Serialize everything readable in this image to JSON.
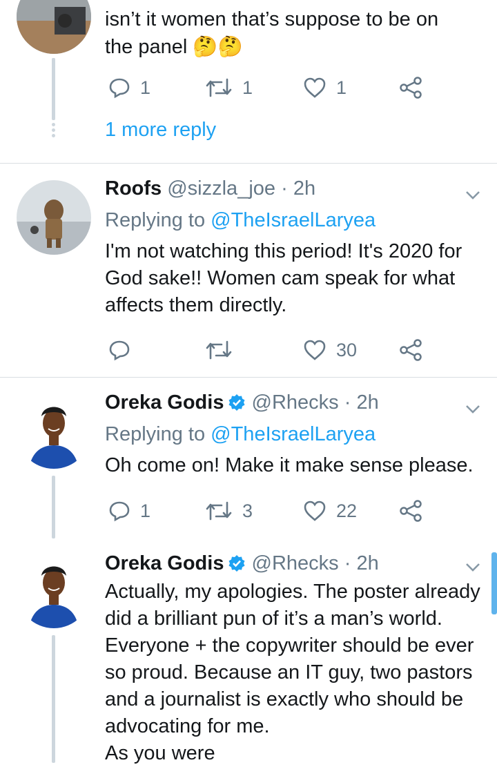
{
  "top_tweet": {
    "text_line1": "isn’t it women that’s suppose to be on",
    "text_line2": "the panel",
    "emoji": "🤔🤔",
    "reply_count": "1",
    "retweet_count": "1",
    "like_count": "1",
    "more_replies": "1 more reply"
  },
  "tweets": [
    {
      "name": "Roofs",
      "handle": "@sizzla_joe",
      "time": "2h",
      "replying_label": "Replying to",
      "replying_to": "@TheIsraelLaryea",
      "text": "I'm not watching this period! It's 2020 for God sake!! Women cam speak for what affects them directly.",
      "reply_count": "",
      "retweet_count": "",
      "like_count": "30"
    },
    {
      "name": "Oreka Godis",
      "handle": "@Rhecks",
      "time": "2h",
      "replying_label": "Replying to",
      "replying_to": "@TheIsraelLaryea",
      "text": "Oh come on! Make it make sense please.",
      "reply_count": "1",
      "retweet_count": "3",
      "like_count": "22"
    },
    {
      "name": "Oreka Godis",
      "handle": "@Rhecks",
      "time": "2h",
      "text": "Actually, my apologies. The poster already did a brilliant pun of it’s a man’s world. Everyone + the copywriter should be ever so proud. Because an IT guy, two pastors and a journalist is exactly who should be advocating for me.",
      "text_cut": "As you were"
    }
  ],
  "colors": {
    "link": "#1da1f2",
    "verified": "#1da1f2",
    "muted": "#657786",
    "thread_line": "#cdd6dd"
  }
}
